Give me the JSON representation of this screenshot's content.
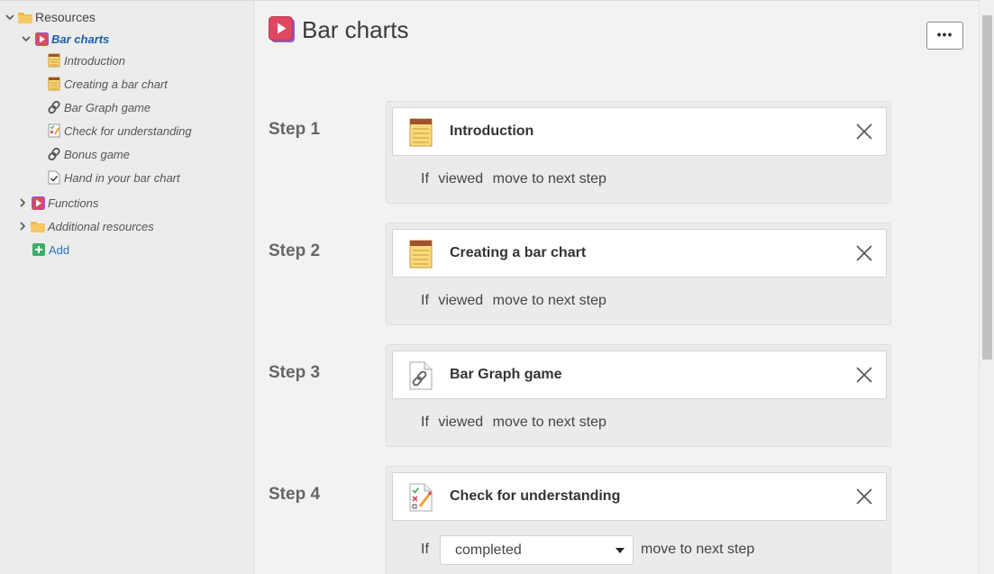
{
  "sidebar": {
    "root": {
      "label": "Resources",
      "icon": "folder-icon"
    },
    "items": [
      {
        "label": "Bar charts",
        "icon": "lesson-play-icon",
        "active": true
      },
      {
        "label": "Introduction",
        "icon": "notepad-icon"
      },
      {
        "label": "Creating a bar chart",
        "icon": "notepad-icon"
      },
      {
        "label": "Bar Graph game",
        "icon": "link-icon"
      },
      {
        "label": "Check for understanding",
        "icon": "quiz-icon"
      },
      {
        "label": "Bonus game",
        "icon": "link-icon"
      },
      {
        "label": "Hand in your bar chart",
        "icon": "assignment-icon"
      },
      {
        "label": "Functions",
        "icon": "lesson-play-icon"
      },
      {
        "label": "Additional resources",
        "icon": "folder-icon"
      }
    ],
    "add_label": "Add"
  },
  "main": {
    "title": "Bar charts",
    "more_label": "•••",
    "steps": [
      {
        "label": "Step 1",
        "name": "Introduction",
        "icon": "notepad-icon",
        "cond_if": "If",
        "cond_value": "viewed",
        "cond_action": "move to next step"
      },
      {
        "label": "Step 2",
        "name": "Creating a bar chart",
        "icon": "notepad-icon",
        "cond_if": "If",
        "cond_value": "viewed",
        "cond_action": "move to next step"
      },
      {
        "label": "Step 3",
        "name": "Bar Graph game",
        "icon": "link-file-icon",
        "cond_if": "If",
        "cond_value": "viewed",
        "cond_action": "move to next step"
      },
      {
        "label": "Step 4",
        "name": "Check for understanding",
        "icon": "quiz-icon",
        "cond_if": "If",
        "cond_value": "completed",
        "cond_action": "move to next step"
      }
    ]
  },
  "colors": {
    "accent_link": "#1a5fa8",
    "lesson_red": "#e0485f",
    "lesson_purple": "#8b5cd6",
    "add_green": "#3cae6a",
    "folder_orange": "#f6b74a"
  }
}
